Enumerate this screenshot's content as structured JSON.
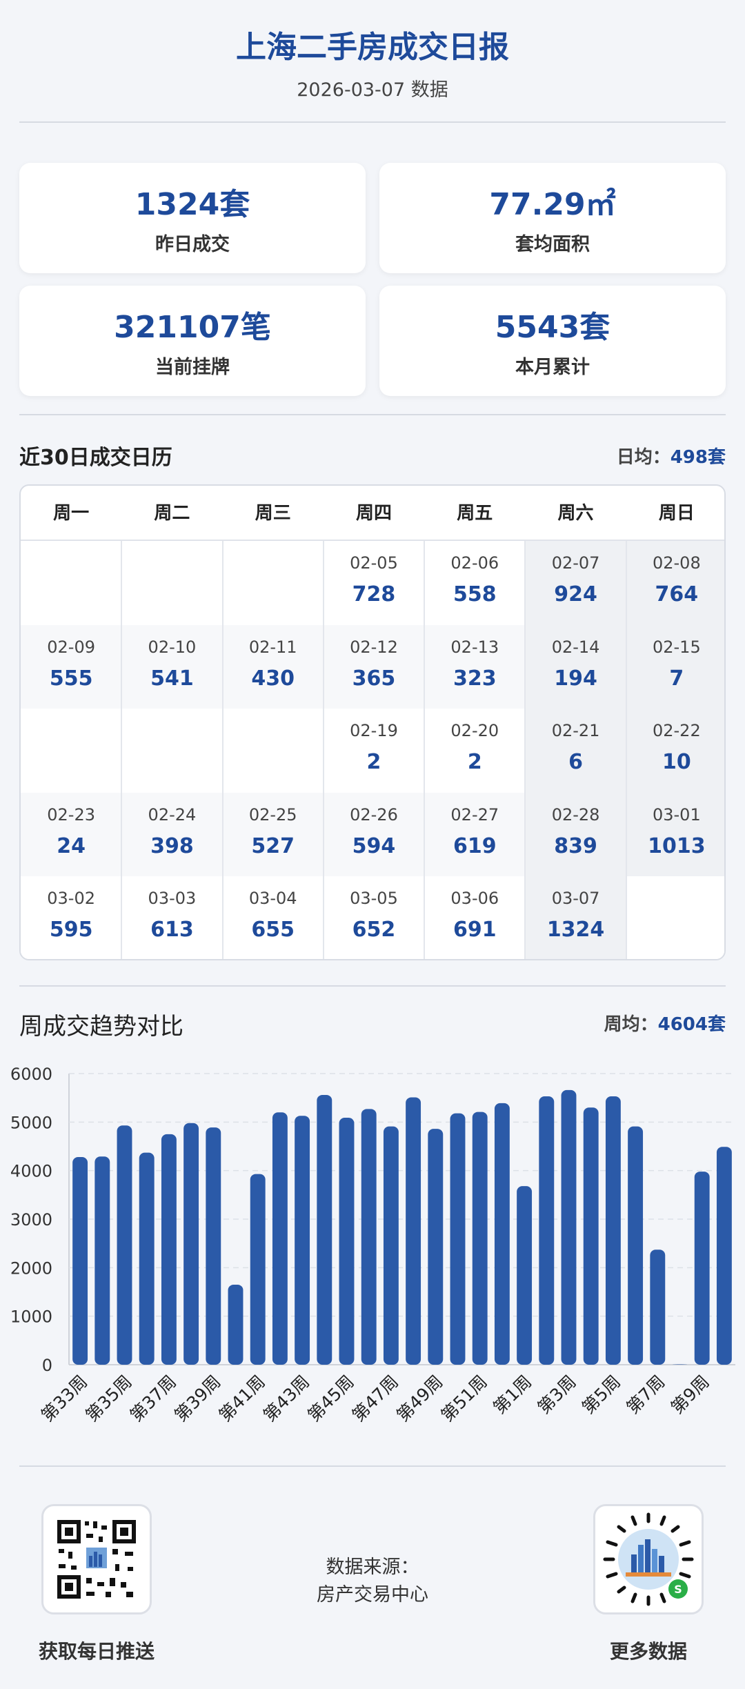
{
  "header": {
    "title": "上海二手房成交日报",
    "subtitle": "2026-03-07 数据"
  },
  "stats": [
    {
      "value": "1324套",
      "label": "昨日成交"
    },
    {
      "value": "77.29㎡",
      "label": "套均面积"
    },
    {
      "value": "321107笔",
      "label": "当前挂牌"
    },
    {
      "value": "5543套",
      "label": "本月累计"
    }
  ],
  "calendar": {
    "title": "近30日成交日历",
    "avg_label": "日均：",
    "avg_value": "498套",
    "weekdays": [
      "周一",
      "周二",
      "周三",
      "周四",
      "周五",
      "周六",
      "周日"
    ],
    "rows": [
      [
        null,
        null,
        null,
        {
          "d": "02-05",
          "n": "728"
        },
        {
          "d": "02-06",
          "n": "558"
        },
        {
          "d": "02-07",
          "n": "924"
        },
        {
          "d": "02-08",
          "n": "764"
        }
      ],
      [
        {
          "d": "02-09",
          "n": "555"
        },
        {
          "d": "02-10",
          "n": "541"
        },
        {
          "d": "02-11",
          "n": "430"
        },
        {
          "d": "02-12",
          "n": "365"
        },
        {
          "d": "02-13",
          "n": "323"
        },
        {
          "d": "02-14",
          "n": "194"
        },
        {
          "d": "02-15",
          "n": "7"
        }
      ],
      [
        null,
        null,
        null,
        {
          "d": "02-19",
          "n": "2"
        },
        {
          "d": "02-20",
          "n": "2"
        },
        {
          "d": "02-21",
          "n": "6"
        },
        {
          "d": "02-22",
          "n": "10"
        }
      ],
      [
        {
          "d": "02-23",
          "n": "24"
        },
        {
          "d": "02-24",
          "n": "398"
        },
        {
          "d": "02-25",
          "n": "527"
        },
        {
          "d": "02-26",
          "n": "594"
        },
        {
          "d": "02-27",
          "n": "619"
        },
        {
          "d": "02-28",
          "n": "839"
        },
        {
          "d": "03-01",
          "n": "1013"
        }
      ],
      [
        {
          "d": "03-02",
          "n": "595"
        },
        {
          "d": "03-03",
          "n": "613"
        },
        {
          "d": "03-04",
          "n": "655"
        },
        {
          "d": "03-05",
          "n": "652"
        },
        {
          "d": "03-06",
          "n": "691"
        },
        {
          "d": "03-07",
          "n": "1324"
        },
        null
      ]
    ]
  },
  "weekly": {
    "title": "周成交趋势对比",
    "avg_label": "周均：",
    "avg_value": "4604套"
  },
  "chart_data": {
    "type": "bar",
    "categories": [
      "第33周",
      "第34周",
      "第35周",
      "第36周",
      "第37周",
      "第38周",
      "第39周",
      "第40周",
      "第41周",
      "第42周",
      "第43周",
      "第44周",
      "第45周",
      "第46周",
      "第47周",
      "第48周",
      "第49周",
      "第50周",
      "第51周",
      "第52周",
      "第1周",
      "第2周",
      "第3周",
      "第4周",
      "第5周",
      "第6周",
      "第7周",
      "第8周",
      "第9周",
      "第10周"
    ],
    "tick_labels": [
      "第33周",
      "第35周",
      "第37周",
      "第39周",
      "第41周",
      "第43周",
      "第45周",
      "第47周",
      "第49周",
      "第51周",
      "第1周",
      "第3周",
      "第5周",
      "第7周",
      "第9周"
    ],
    "values": [
      4280,
      4290,
      4930,
      4370,
      4750,
      4980,
      4890,
      1650,
      3930,
      5200,
      5130,
      5560,
      5090,
      5270,
      4910,
      5510,
      4860,
      5180,
      5210,
      5390,
      3680,
      5530,
      5660,
      5300,
      5530,
      4910,
      2370,
      0,
      3980,
      4490
    ],
    "ylim": [
      0,
      6000
    ],
    "yticks": [
      0,
      1000,
      2000,
      3000,
      4000,
      5000,
      6000
    ],
    "bar_color": "#2b5aa8",
    "grid": true
  },
  "footer": {
    "source_line1": "数据来源：",
    "source_line2": "房产交易中心",
    "left_qr_label": "获取每日推送",
    "right_qr_label": "更多数据"
  }
}
